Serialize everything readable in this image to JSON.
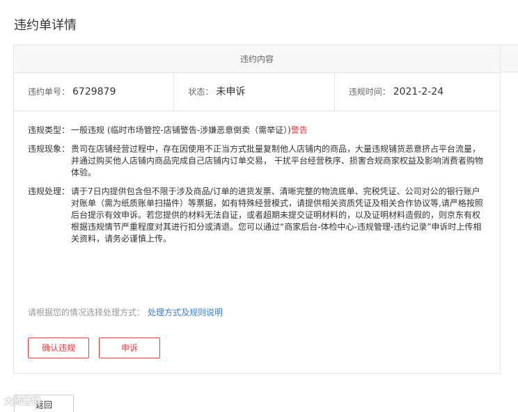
{
  "page": {
    "title": "违约单详情"
  },
  "panel": {
    "header": "违约内容"
  },
  "info": {
    "order_label": "违约单号：",
    "order_value": "6729879",
    "status_label": "状态：",
    "status_value": "未申诉",
    "time_label": "违规时间：",
    "time_value": "2021-2-24"
  },
  "detail": {
    "type_label": "违规类型：",
    "type_value": "一般违规 (临时市场管控-店铺警告-涉嫌恶意倒卖（需举证）)",
    "type_badge": "警告",
    "phenomenon_label": "违规现象：",
    "phenomenon_value": "贵司在店铺经营过程中，存在因使用不正当方式批量复制他人店铺内的商品，大量违规铺货恶意挤占平台流量，并通过购买他人店铺内商品完成自己店铺内订单交易， 干扰平台经营秩序、损害合规商家权益及影响消费者购物体验。",
    "handling_label": "违规处理：",
    "handling_value": "请于7日内提供包含但不限于涉及商品/订单的进货发票、清晰完整的物流底单、完税凭证、公司对公的银行账户对账单（需为纸质账单扫描件）等票据，如有特殊经营模式，请提供相关资质凭证及相关合作协议等,请严格按照后台提示有效申诉。若您提供的材料无法自证，或者超期未提交证明材料的，以及证明材料造假的，则京东有权根据违规情节严重程度对其进行扣分或清退。您可以通过“商家后台-体检中心-违规管理-违约记录”申诉时上传相关资料，请务必谨慎上传。"
  },
  "hint": {
    "text": "请根据您的情况选择处理方式：",
    "link": "处理方式及规则说明"
  },
  "buttons": {
    "confirm": "确认违规",
    "appeal": "申诉",
    "back": "返回"
  },
  "watermark": {
    "text": "大师营销"
  },
  "colors": {
    "accent": "#e4393c",
    "link": "#3b7cd6",
    "border": "#e5e5e5"
  }
}
